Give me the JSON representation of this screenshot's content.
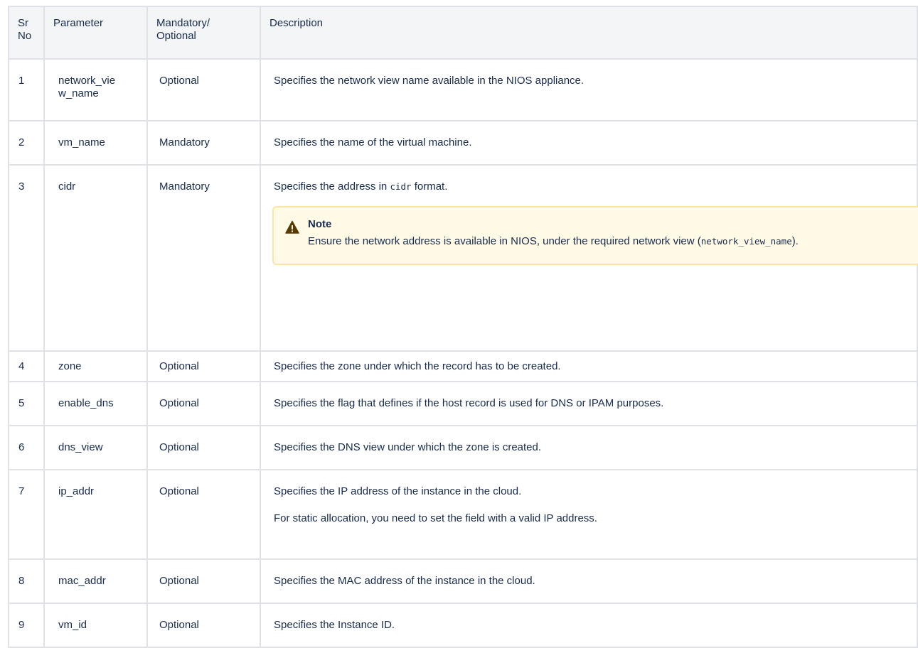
{
  "header": {
    "sr_no": "Sr No",
    "parameter": "Parameter",
    "mandatory_optional": "Mandatory/ Optional",
    "description": "Description"
  },
  "rows": [
    {
      "sr": "1",
      "param": "network_view_name",
      "req": "Optional",
      "desc": "Specifies the network view name available in the NIOS appliance."
    },
    {
      "sr": "2",
      "param": "vm_name",
      "req": "Mandatory",
      "desc": "Specifies the name of the virtual machine."
    },
    {
      "sr": "3",
      "param": "cidr",
      "req": "Mandatory",
      "desc_pre": "Specifies the address in ",
      "desc_code": "cidr",
      "desc_post": " format.",
      "note": {
        "title": "Note",
        "body_pre": "Ensure the network address is available in NIOS, under the required network view (",
        "body_code": "network_view_name",
        "body_post": ")."
      }
    },
    {
      "sr": "4",
      "param": "zone",
      "req": "Optional",
      "desc": "Specifies the zone under which the record has to be created."
    },
    {
      "sr": "5",
      "param": "enable_dns",
      "req": "Optional",
      "desc": "Specifies the flag that defines if the host record is used for DNS or IPAM purposes."
    },
    {
      "sr": "6",
      "param": "dns_view",
      "req": "Optional",
      "desc": "Specifies the DNS view under which the zone is created."
    },
    {
      "sr": "7",
      "param": "ip_addr",
      "req": "Optional",
      "desc": "Specifies the IP address of the instance in the cloud.",
      "desc2": "For static allocation, you need to set the field with a valid IP address."
    },
    {
      "sr": "8",
      "param": "mac_addr",
      "req": "Optional",
      "desc": "Specifies the MAC address of the instance in the cloud."
    },
    {
      "sr": "9",
      "param": "vm_id",
      "req": "Optional",
      "desc": "Specifies the Instance ID."
    }
  ],
  "icons": {
    "note": "warning-icon"
  },
  "colors": {
    "note_bg": "#fffae6",
    "note_border": "#ffe5a1",
    "icon": "#5b3a00"
  }
}
